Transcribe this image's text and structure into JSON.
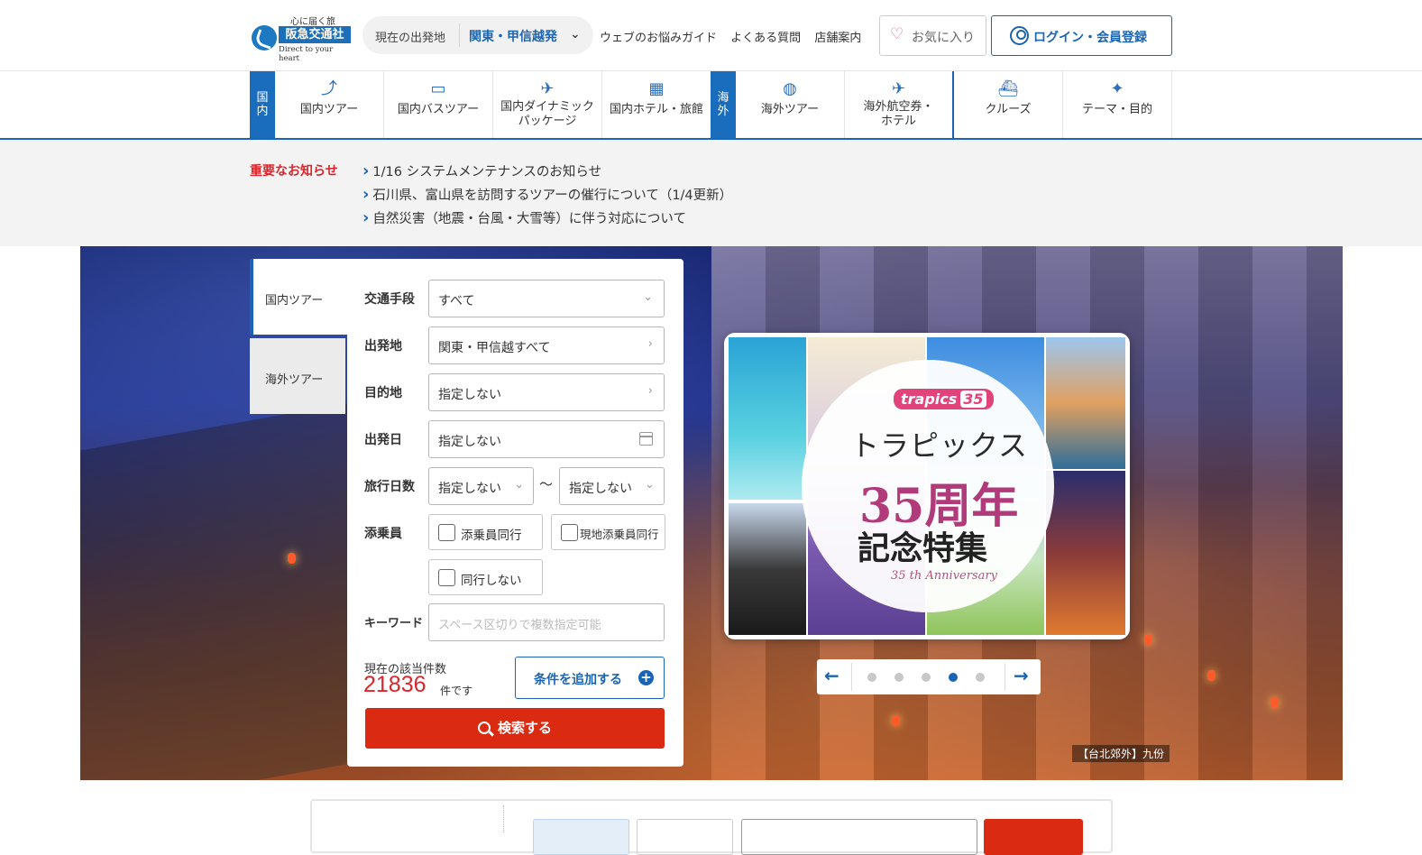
{
  "header": {
    "logo_tag": "心に届く旅",
    "logo_name": "阪急交通社",
    "logo_sub": "Direct to your heart",
    "origin_label": "現在の出発地",
    "origin_value": "関東・甲信越発",
    "links": [
      "ウェブのお悩みガイド",
      "よくある質問",
      "店舗案内"
    ],
    "favorites": "お気に入り",
    "login": "ログイン・会員登録"
  },
  "nav": {
    "domestic_region": "国内",
    "overseas_region": "海外",
    "domestic": [
      {
        "label": "国内ツアー",
        "icon": "route-icon"
      },
      {
        "label": "国内バスツアー",
        "icon": "bus-icon"
      },
      {
        "label": "国内ダイナミックパッケージ",
        "line1": "国内ダイナミック",
        "line2": "パッケージ",
        "icon": "plane-building-icon"
      },
      {
        "label": "国内ホテル・旅館",
        "icon": "hotel-icon"
      }
    ],
    "overseas": [
      {
        "label": "海外ツアー",
        "icon": "globe-icon"
      },
      {
        "label": "海外航空券・ホテル",
        "line1": "海外航空券・",
        "line2": "ホテル",
        "icon": "plane-building-icon"
      },
      {
        "label": "クルーズ",
        "icon": "ship-icon"
      },
      {
        "label": "テーマ・目的",
        "icon": "sparkle-icon"
      }
    ]
  },
  "notice": {
    "title": "重要なお知らせ",
    "items": [
      "1/16 システムメンテナンスのお知らせ",
      "石川県、富山県を訪問するツアーの催行について（1/4更新）",
      "自然災害（地震・台風・大雪等）に伴う対応について"
    ]
  },
  "search": {
    "tab_domestic": "国内ツアー",
    "tab_overseas": "海外ツアー",
    "transport_label": "交通手段",
    "transport_value": "すべて",
    "departure_label": "出発地",
    "departure_value": "関東・甲信越すべて",
    "destination_label": "目的地",
    "destination_value": "指定しない",
    "date_label": "出発日",
    "date_value": "指定しない",
    "days_label": "旅行日数",
    "days_from": "指定しない",
    "days_to": "指定しない",
    "tilde": "〜",
    "escort_label": "添乗員",
    "escort_options": [
      "添乗員同行",
      "現地添乗員同行",
      "同行しない"
    ],
    "keyword_label": "キーワード",
    "keyword_placeholder": "スペース区切りで複数指定可能",
    "count_label": "現在の該当件数",
    "count": "21836",
    "count_unit": "件です",
    "add_condition": "条件を追加する",
    "search_button": "検索する"
  },
  "hero": {
    "caption": "【台北郊外】九份"
  },
  "banner": {
    "brand": "trapics",
    "brand_num": "35",
    "title1": "トラピックス",
    "title2": "35周年",
    "title3": "記念特集",
    "anniv": "35 th Anniversary",
    "active_dot": 4,
    "dot_count": 5
  },
  "colors": {
    "brand_blue": "#1a65b3",
    "search_red": "#db2a12",
    "notice_red": "#d8262c"
  }
}
